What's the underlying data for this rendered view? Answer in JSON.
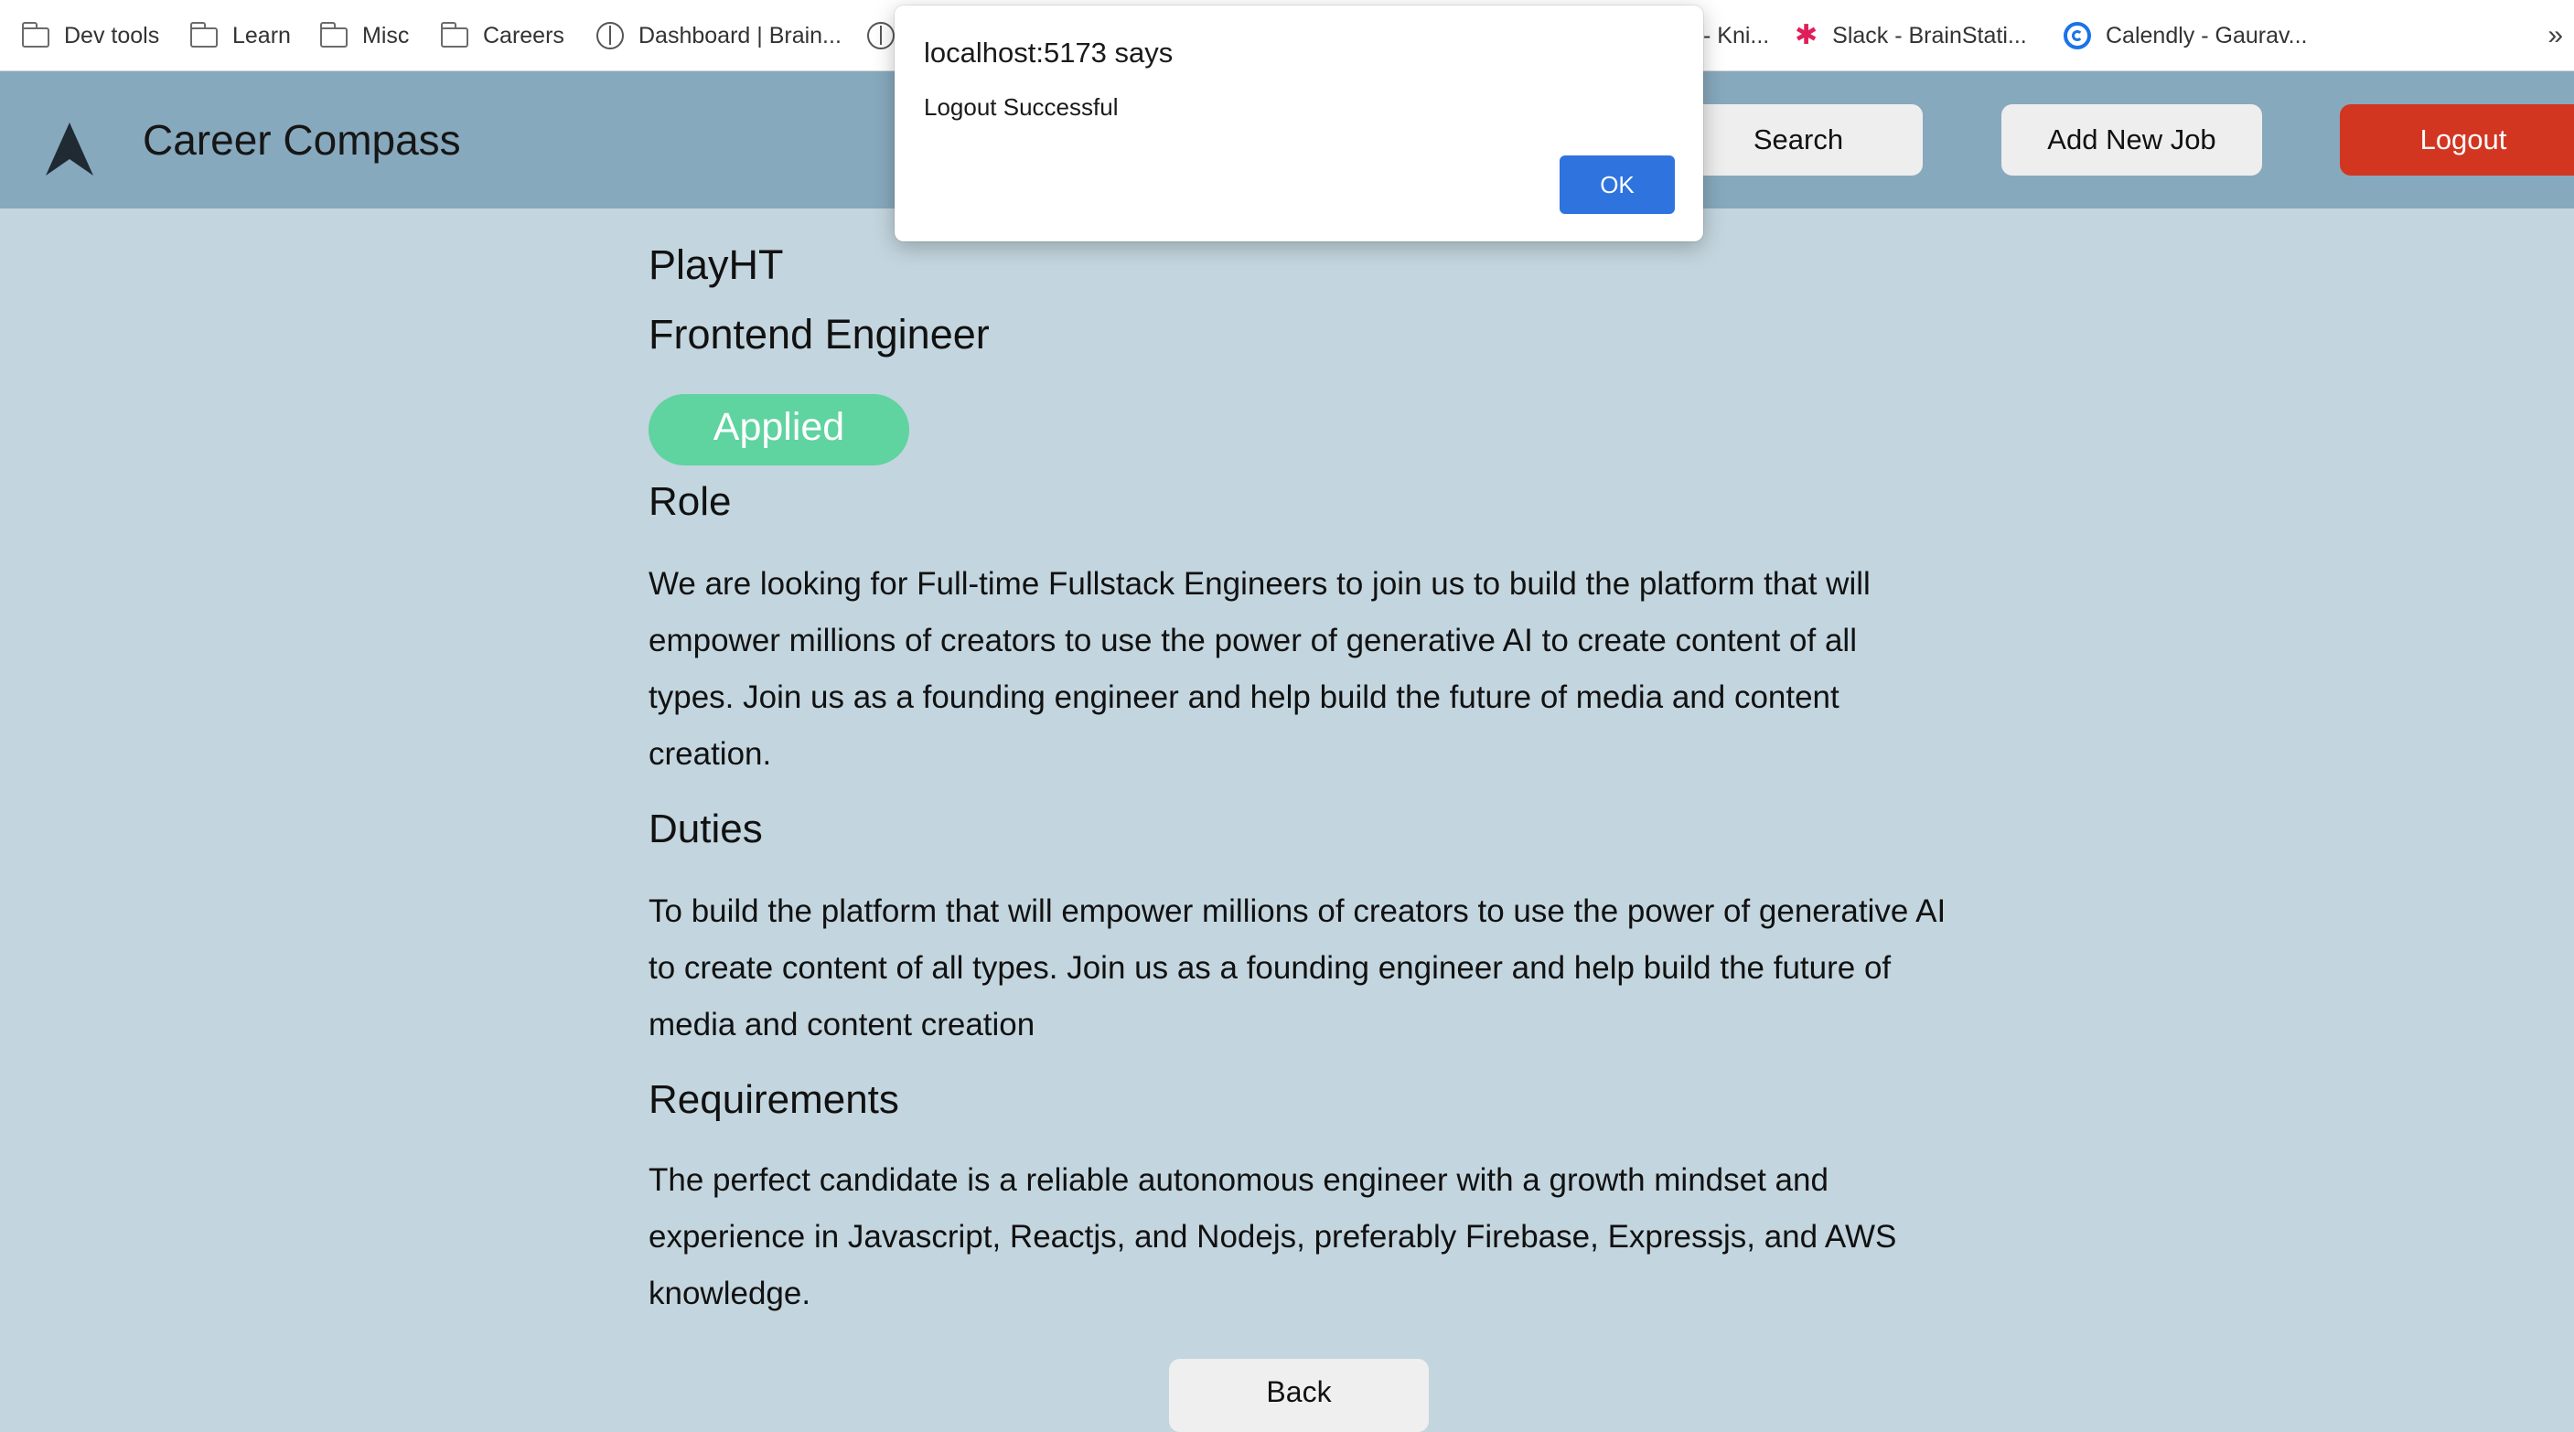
{
  "bookmarks": {
    "items": [
      {
        "label": "Dev tools",
        "icon": "folder-icon"
      },
      {
        "label": "Learn",
        "icon": "folder-icon"
      },
      {
        "label": "Misc",
        "icon": "folder-icon"
      },
      {
        "label": "Careers",
        "icon": "folder-icon"
      },
      {
        "label": "Dashboard | Brain...",
        "icon": "brain-icon"
      },
      {
        "label": "- Kni...",
        "icon": ""
      },
      {
        "label": "Slack - BrainStati...",
        "icon": "slack-icon"
      },
      {
        "label": "Calendly - Gaurav...",
        "icon": "calendly-icon"
      }
    ],
    "overflow": "»"
  },
  "header": {
    "title": "Career Compass",
    "search_label": "Search",
    "add_label": "Add New Job",
    "logout_label": "Logout"
  },
  "job": {
    "company": "PlayHT",
    "title": "Frontend Engineer",
    "status": "Applied",
    "sections": [
      {
        "heading": "Role",
        "body": "We are looking for Full-time Fullstack Engineers to join us to build the platform that will empower millions of creators to use the power of generative AI to create content of all types. Join us as a founding engineer and help build the future of media and content creation."
      },
      {
        "heading": "Duties",
        "body": "To build the platform that will empower millions of creators to use the power of generative AI to create content of all types. Join us as a founding engineer and help build the future of media and content creation"
      },
      {
        "heading": "Requirements",
        "body": "The perfect candidate is a reliable autonomous engineer with a growth mindset and experience in Javascript, Reactjs, and Nodejs, preferably Firebase, Expressjs, and AWS knowledge."
      }
    ],
    "back_label": "Back"
  },
  "alert": {
    "title": "localhost:5173 says",
    "message": "Logout Successful",
    "ok_label": "OK"
  },
  "colors": {
    "page_bg": "#c3d5de",
    "header_bg": "#87a9bd",
    "logout": "#d23621",
    "status_badge": "#5fd3a0",
    "ok_button": "#2f73de"
  }
}
